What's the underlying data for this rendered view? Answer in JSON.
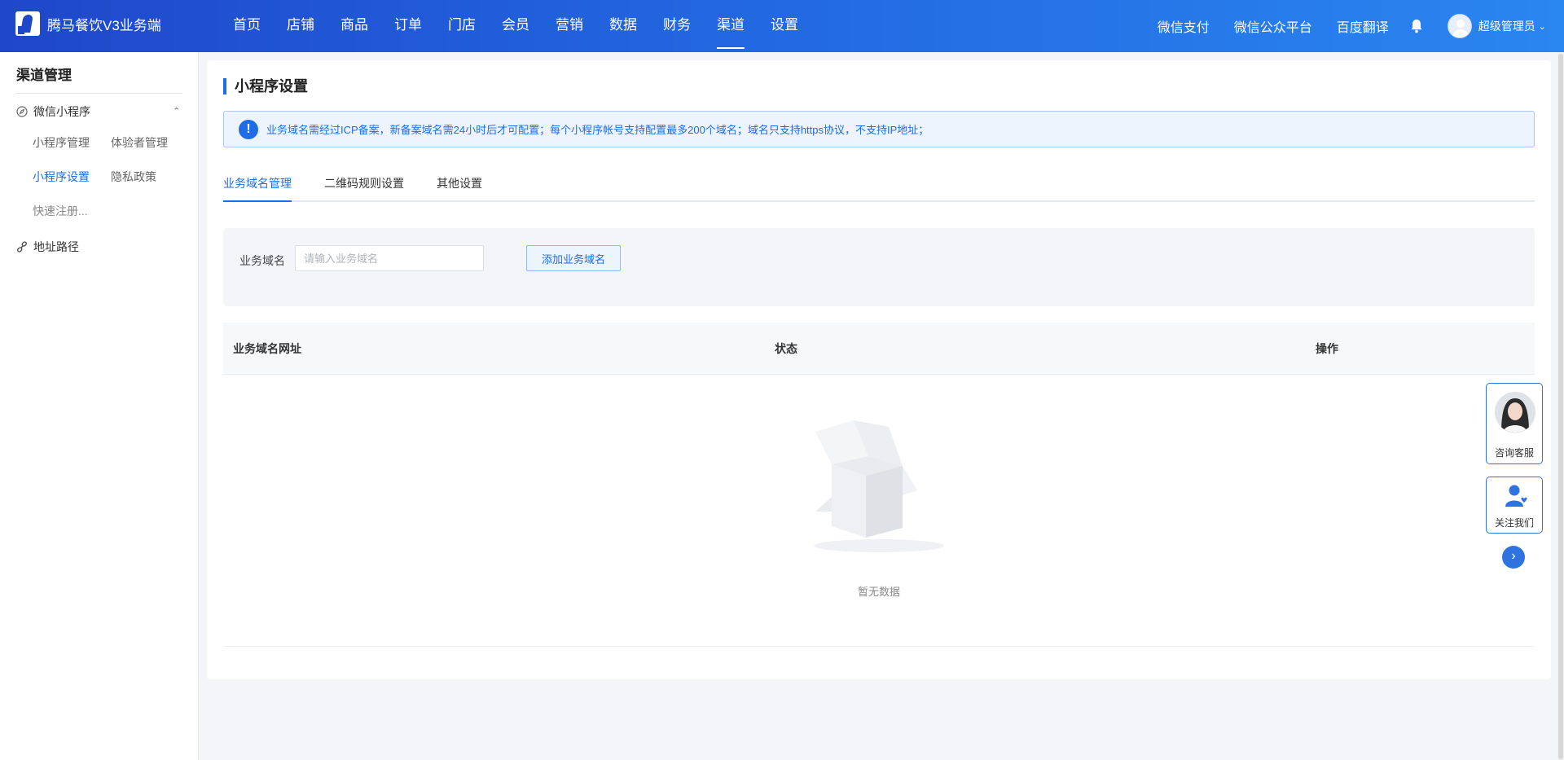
{
  "header": {
    "brand": "腾马餐饮V3业务端",
    "nav": [
      {
        "label": "首页"
      },
      {
        "label": "店铺"
      },
      {
        "label": "商品"
      },
      {
        "label": "订单"
      },
      {
        "label": "门店"
      },
      {
        "label": "会员"
      },
      {
        "label": "营销"
      },
      {
        "label": "数据"
      },
      {
        "label": "财务"
      },
      {
        "label": "渠道"
      },
      {
        "label": "设置"
      }
    ],
    "active_nav": "渠道",
    "links": [
      "微信支付",
      "微信公众平台",
      "百度翻译"
    ],
    "user": "超级管理员"
  },
  "sidebar": {
    "title": "渠道管理",
    "group1": "微信小程序",
    "sub": [
      "小程序管理",
      "体验者管理",
      "小程序设置",
      "隐私政策",
      "快速注册..."
    ],
    "group2": "地址路径"
  },
  "main": {
    "title": "小程序设置",
    "notice": "业务域名需经过ICP备案，新备案域名需24小时后才可配置；每个小程序帐号支持配置最多200个域名；域名只支持https协议，不支持IP地址；",
    "tabs": [
      "业务域名管理",
      "二维码规则设置",
      "其他设置"
    ],
    "form": {
      "label": "业务域名",
      "placeholder": "请输入业务域名",
      "value": "",
      "button": "添加业务域名"
    },
    "table": {
      "columns": [
        "业务域名网址",
        "状态",
        "操作"
      ],
      "empty_text": "暂无数据"
    }
  },
  "widgets": {
    "consult": "咨询客服",
    "follow": "关注我们"
  },
  "colors": {
    "primary": "#1e6de6",
    "header_start": "#1f47c9",
    "header_end": "#2a86f0"
  }
}
